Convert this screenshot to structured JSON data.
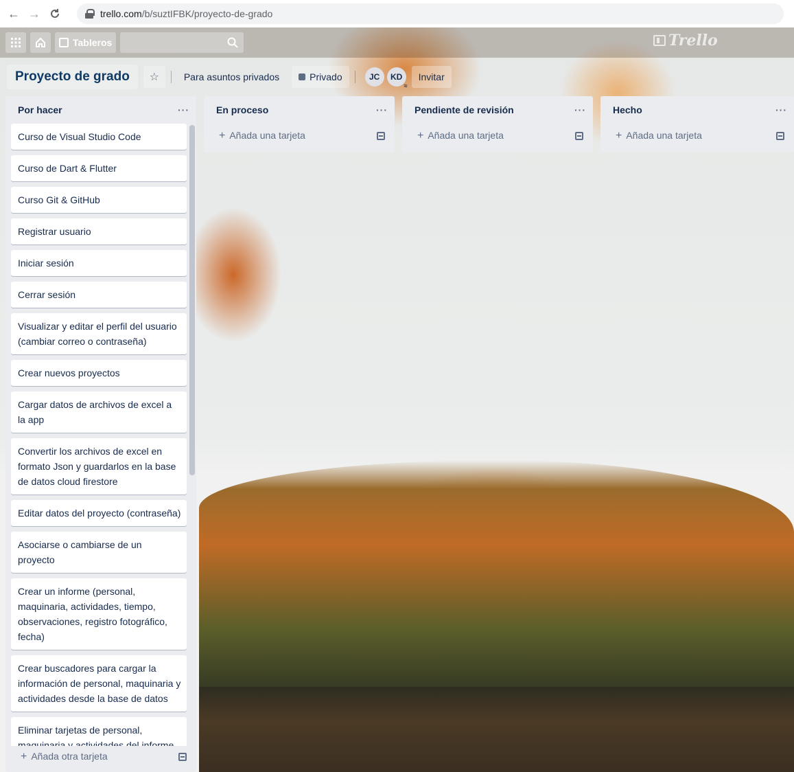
{
  "browser": {
    "back": "←",
    "forward": "→",
    "reload": "C",
    "url_host": "trello.com",
    "url_path": "/b/suztIFBK/proyecto-de-grado"
  },
  "header": {
    "apps_icon": "grid-icon",
    "home_icon": "home-icon",
    "boards_label": "Tableros",
    "search_icon": "search-icon",
    "brand": "Trello"
  },
  "board": {
    "title": "Proyecto de grado",
    "star": "☆",
    "team": "Para asuntos privados",
    "visibility": "Privado",
    "members": [
      "JC",
      "KD"
    ],
    "member_badge": "≈",
    "invite": "Invitar"
  },
  "lists": [
    {
      "title": "Por hacer",
      "menu": "···",
      "cards": [
        "Curso de Visual Studio Code",
        "Curso de Dart & Flutter",
        "Curso Git & GitHub",
        "Registrar usuario",
        "Iniciar sesión",
        "Cerrar sesión",
        "Visualizar y editar el perfil del usuario (cambiar correo o contraseña)",
        "Crear nuevos proyectos",
        "Cargar datos de archivos de excel a la app",
        "Convertir los archivos de excel en formato Json y guardarlos en la base de datos cloud firestore",
        "Editar datos del proyecto (contraseña)",
        "Asociarse o cambiarse de un proyecto",
        "Crear un informe (personal, maquinaria, actividades, tiempo, observaciones, registro fotográfico, fecha)",
        "Crear buscadores para cargar la información de personal, maquinaria y actividades desde la base de datos",
        "Eliminar tarjetas de personal, maquinaria y actividades del informe"
      ],
      "add": "Añada otra tarjeta"
    },
    {
      "title": "En proceso",
      "menu": "···",
      "add": "Añada una tarjeta"
    },
    {
      "title": "Pendiente de revisión",
      "menu": "···",
      "add": "Añada una tarjeta"
    },
    {
      "title": "Hecho",
      "menu": "···",
      "add": "Añada una tarjeta"
    }
  ],
  "plus": "+"
}
